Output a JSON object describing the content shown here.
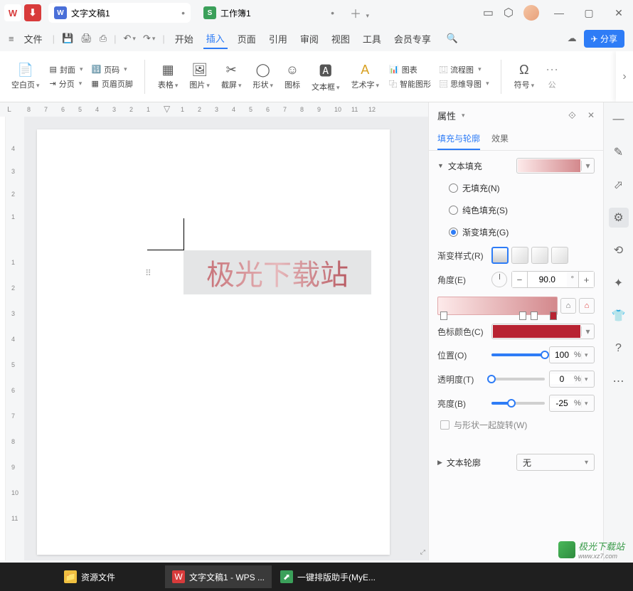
{
  "tabs": [
    {
      "icon": "W",
      "label": "文字文稿1"
    },
    {
      "icon": "S",
      "label": "工作簿1"
    }
  ],
  "menubar": {
    "file": "文件",
    "items": [
      "开始",
      "插入",
      "页面",
      "引用",
      "审阅",
      "视图",
      "工具",
      "会员专享"
    ],
    "active": "插入",
    "share": "分享"
  },
  "ribbon": {
    "blank_page": "空白页",
    "cover": "封面",
    "page_number": "页码",
    "pagination": "分页",
    "header_footer": "页眉页脚",
    "table": "表格",
    "picture": "图片",
    "screenshot": "截屏",
    "shape": "形状",
    "icon": "图标",
    "textbox": "文本框",
    "wordart": "艺术字",
    "chart": "图表",
    "smartart": "智能图形",
    "flowchart": "流程图",
    "mindmap": "思维导图",
    "symbol": "符号",
    "pub": "公"
  },
  "ruler": {
    "corner": "L",
    "h": [
      "8",
      "7",
      "6",
      "5",
      "4",
      "3",
      "2",
      "1",
      "",
      "1",
      "2",
      "3",
      "4",
      "5",
      "6",
      "7",
      "8",
      "9",
      "10",
      "11",
      "12"
    ],
    "v": [
      "4",
      "3",
      "2",
      "1",
      "",
      "1",
      "2",
      "3",
      "4",
      "5",
      "6",
      "7",
      "8",
      "9",
      "10",
      "11"
    ]
  },
  "canvas_text": "极光下载站",
  "props": {
    "title": "属性",
    "tab_fill": "填充与轮廓",
    "tab_effect": "效果",
    "text_fill": "文本填充",
    "no_fill": "无填充(N)",
    "solid_fill": "纯色填充(S)",
    "gradient_fill": "渐变填充(G)",
    "gradient_style": "渐变样式(R)",
    "angle": "角度(E)",
    "angle_value": "90.0",
    "angle_unit": "°",
    "stop_color": "色标颜色(C)",
    "position": "位置(O)",
    "position_value": "100",
    "transparency": "透明度(T)",
    "transparency_value": "0",
    "brightness": "亮度(B)",
    "brightness_value": "-25",
    "percent": "%",
    "rotate_with_shape": "与形状一起旋转(W)",
    "text_outline": "文本轮廓",
    "outline_none": "无"
  },
  "taskbar": {
    "item1": "资源文件",
    "item2": "文字文稿1 - WPS ...",
    "item3": "一键排版助手(MyE..."
  },
  "watermark": {
    "name": "极光下载站",
    "url": "www.xz7.com"
  }
}
